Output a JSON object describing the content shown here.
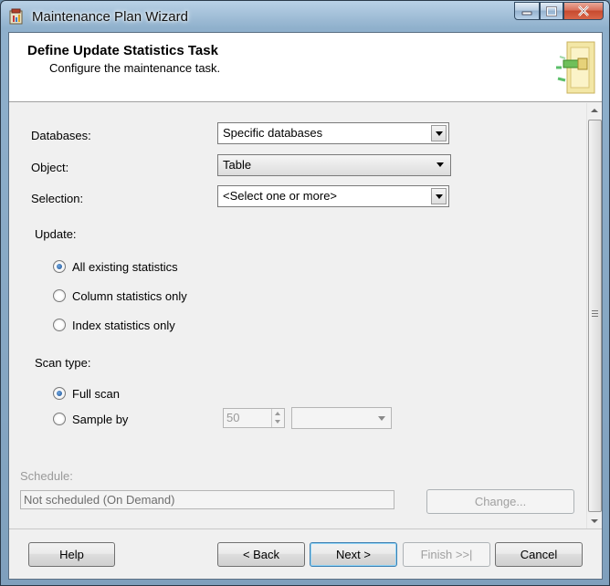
{
  "window": {
    "title": "Maintenance Plan Wizard",
    "accent": "#8fb0cc"
  },
  "header": {
    "title": "Define Update Statistics Task",
    "subtitle": "Configure the maintenance task."
  },
  "form": {
    "databases": {
      "label": "Databases:",
      "value": "Specific databases"
    },
    "object": {
      "label": "Object:",
      "value": "Table"
    },
    "selection": {
      "label": "Selection:",
      "value": "<Select one or more>"
    },
    "update": {
      "label": "Update:",
      "options": [
        {
          "label": "All existing statistics",
          "checked": true
        },
        {
          "label": "Column statistics only",
          "checked": false
        },
        {
          "label": "Index statistics only",
          "checked": false
        }
      ]
    },
    "scan_type": {
      "label": "Scan type:",
      "full_scan": {
        "label": "Full scan",
        "checked": true
      },
      "sample_by": {
        "label": "Sample by",
        "checked": false,
        "value": "50",
        "unit": ""
      }
    },
    "schedule": {
      "label": "Schedule:",
      "value": "Not scheduled (On Demand)",
      "change_label": "Change..."
    }
  },
  "footer": {
    "help": "Help",
    "back": "< Back",
    "next": "Next >",
    "finish": "Finish >>|",
    "cancel": "Cancel"
  }
}
